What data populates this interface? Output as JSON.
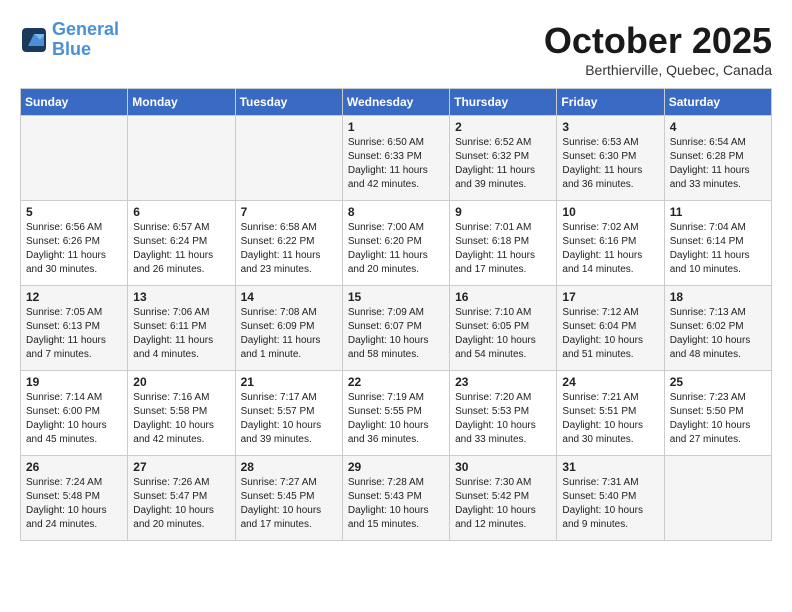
{
  "header": {
    "logo_line1": "General",
    "logo_line2": "Blue",
    "month": "October 2025",
    "location": "Berthierville, Quebec, Canada"
  },
  "days_of_week": [
    "Sunday",
    "Monday",
    "Tuesday",
    "Wednesday",
    "Thursday",
    "Friday",
    "Saturday"
  ],
  "weeks": [
    [
      {
        "day": "",
        "info": ""
      },
      {
        "day": "",
        "info": ""
      },
      {
        "day": "",
        "info": ""
      },
      {
        "day": "1",
        "info": "Sunrise: 6:50 AM\nSunset: 6:33 PM\nDaylight: 11 hours\nand 42 minutes."
      },
      {
        "day": "2",
        "info": "Sunrise: 6:52 AM\nSunset: 6:32 PM\nDaylight: 11 hours\nand 39 minutes."
      },
      {
        "day": "3",
        "info": "Sunrise: 6:53 AM\nSunset: 6:30 PM\nDaylight: 11 hours\nand 36 minutes."
      },
      {
        "day": "4",
        "info": "Sunrise: 6:54 AM\nSunset: 6:28 PM\nDaylight: 11 hours\nand 33 minutes."
      }
    ],
    [
      {
        "day": "5",
        "info": "Sunrise: 6:56 AM\nSunset: 6:26 PM\nDaylight: 11 hours\nand 30 minutes."
      },
      {
        "day": "6",
        "info": "Sunrise: 6:57 AM\nSunset: 6:24 PM\nDaylight: 11 hours\nand 26 minutes."
      },
      {
        "day": "7",
        "info": "Sunrise: 6:58 AM\nSunset: 6:22 PM\nDaylight: 11 hours\nand 23 minutes."
      },
      {
        "day": "8",
        "info": "Sunrise: 7:00 AM\nSunset: 6:20 PM\nDaylight: 11 hours\nand 20 minutes."
      },
      {
        "day": "9",
        "info": "Sunrise: 7:01 AM\nSunset: 6:18 PM\nDaylight: 11 hours\nand 17 minutes."
      },
      {
        "day": "10",
        "info": "Sunrise: 7:02 AM\nSunset: 6:16 PM\nDaylight: 11 hours\nand 14 minutes."
      },
      {
        "day": "11",
        "info": "Sunrise: 7:04 AM\nSunset: 6:14 PM\nDaylight: 11 hours\nand 10 minutes."
      }
    ],
    [
      {
        "day": "12",
        "info": "Sunrise: 7:05 AM\nSunset: 6:13 PM\nDaylight: 11 hours\nand 7 minutes."
      },
      {
        "day": "13",
        "info": "Sunrise: 7:06 AM\nSunset: 6:11 PM\nDaylight: 11 hours\nand 4 minutes."
      },
      {
        "day": "14",
        "info": "Sunrise: 7:08 AM\nSunset: 6:09 PM\nDaylight: 11 hours\nand 1 minute."
      },
      {
        "day": "15",
        "info": "Sunrise: 7:09 AM\nSunset: 6:07 PM\nDaylight: 10 hours\nand 58 minutes."
      },
      {
        "day": "16",
        "info": "Sunrise: 7:10 AM\nSunset: 6:05 PM\nDaylight: 10 hours\nand 54 minutes."
      },
      {
        "day": "17",
        "info": "Sunrise: 7:12 AM\nSunset: 6:04 PM\nDaylight: 10 hours\nand 51 minutes."
      },
      {
        "day": "18",
        "info": "Sunrise: 7:13 AM\nSunset: 6:02 PM\nDaylight: 10 hours\nand 48 minutes."
      }
    ],
    [
      {
        "day": "19",
        "info": "Sunrise: 7:14 AM\nSunset: 6:00 PM\nDaylight: 10 hours\nand 45 minutes."
      },
      {
        "day": "20",
        "info": "Sunrise: 7:16 AM\nSunset: 5:58 PM\nDaylight: 10 hours\nand 42 minutes."
      },
      {
        "day": "21",
        "info": "Sunrise: 7:17 AM\nSunset: 5:57 PM\nDaylight: 10 hours\nand 39 minutes."
      },
      {
        "day": "22",
        "info": "Sunrise: 7:19 AM\nSunset: 5:55 PM\nDaylight: 10 hours\nand 36 minutes."
      },
      {
        "day": "23",
        "info": "Sunrise: 7:20 AM\nSunset: 5:53 PM\nDaylight: 10 hours\nand 33 minutes."
      },
      {
        "day": "24",
        "info": "Sunrise: 7:21 AM\nSunset: 5:51 PM\nDaylight: 10 hours\nand 30 minutes."
      },
      {
        "day": "25",
        "info": "Sunrise: 7:23 AM\nSunset: 5:50 PM\nDaylight: 10 hours\nand 27 minutes."
      }
    ],
    [
      {
        "day": "26",
        "info": "Sunrise: 7:24 AM\nSunset: 5:48 PM\nDaylight: 10 hours\nand 24 minutes."
      },
      {
        "day": "27",
        "info": "Sunrise: 7:26 AM\nSunset: 5:47 PM\nDaylight: 10 hours\nand 20 minutes."
      },
      {
        "day": "28",
        "info": "Sunrise: 7:27 AM\nSunset: 5:45 PM\nDaylight: 10 hours\nand 17 minutes."
      },
      {
        "day": "29",
        "info": "Sunrise: 7:28 AM\nSunset: 5:43 PM\nDaylight: 10 hours\nand 15 minutes."
      },
      {
        "day": "30",
        "info": "Sunrise: 7:30 AM\nSunset: 5:42 PM\nDaylight: 10 hours\nand 12 minutes."
      },
      {
        "day": "31",
        "info": "Sunrise: 7:31 AM\nSunset: 5:40 PM\nDaylight: 10 hours\nand 9 minutes."
      },
      {
        "day": "",
        "info": ""
      }
    ]
  ]
}
